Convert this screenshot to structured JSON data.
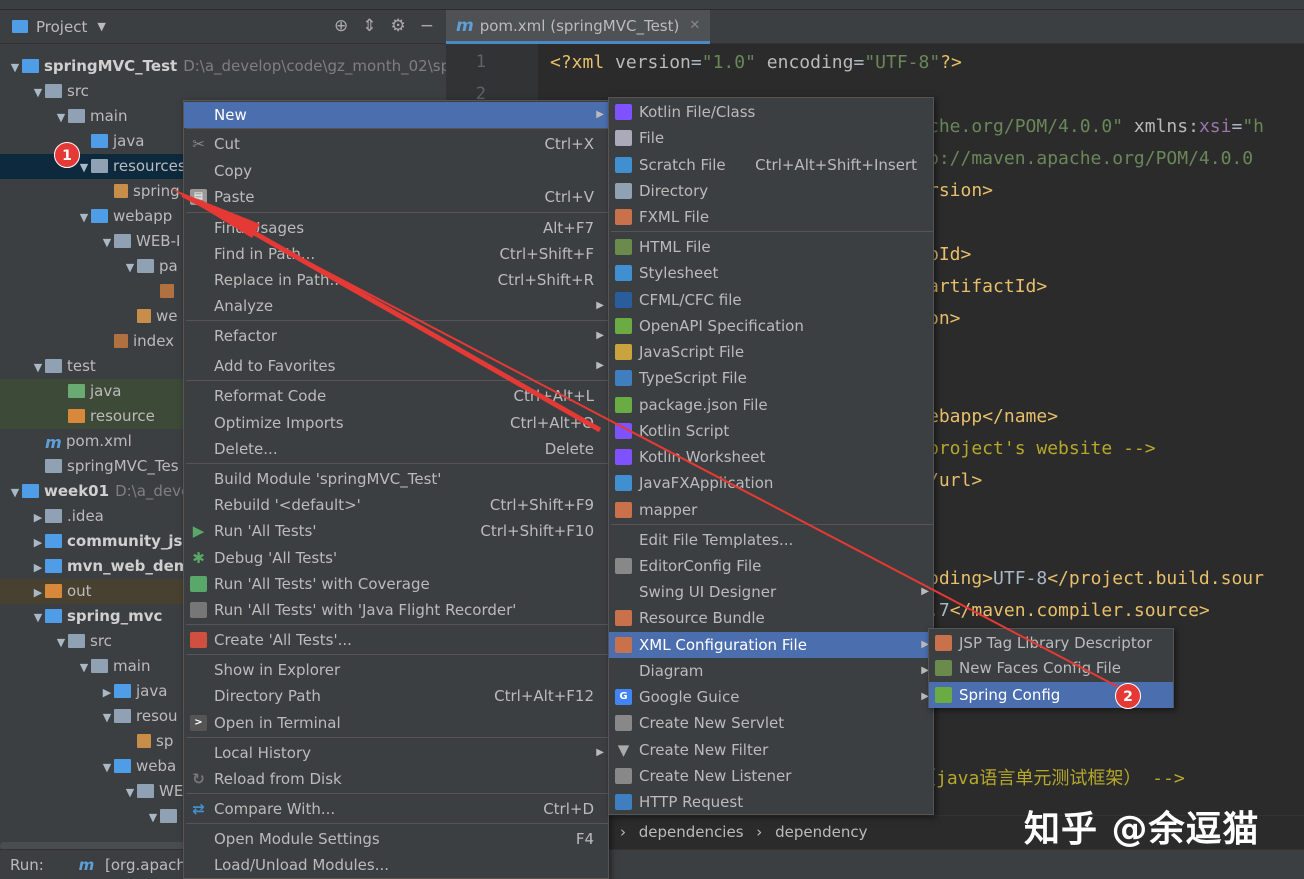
{
  "project_panel": {
    "title": "Project",
    "tree": [
      {
        "label": "springMVC_Test",
        "path": "D:\\a_develop\\code\\gz_month_02\\sp",
        "bold": true
      },
      {
        "label": "src"
      },
      {
        "label": "main"
      },
      {
        "label": "java"
      },
      {
        "label": "resources"
      },
      {
        "label": "spring"
      },
      {
        "label": "webapp"
      },
      {
        "label": "WEB-I"
      },
      {
        "label": "pa"
      },
      {
        "label": ""
      },
      {
        "label": "we"
      },
      {
        "label": "index"
      },
      {
        "label": "test"
      },
      {
        "label": "java"
      },
      {
        "label": "resource"
      },
      {
        "label": "pom.xml"
      },
      {
        "label": "springMVC_Tes"
      },
      {
        "label": "week01",
        "path": "D:\\a_deve",
        "bold": true
      },
      {
        "label": ".idea"
      },
      {
        "label": "community_jsp",
        "bold": true
      },
      {
        "label": "mvn_web_dem",
        "bold": true
      },
      {
        "label": "out"
      },
      {
        "label": "spring_mvc",
        "bold": true
      },
      {
        "label": "src"
      },
      {
        "label": "main"
      },
      {
        "label": "java"
      },
      {
        "label": "resou"
      },
      {
        "label": "sp"
      },
      {
        "label": "weba"
      },
      {
        "label": "WE"
      },
      {
        "label": ""
      }
    ]
  },
  "editor": {
    "tab_label": "pom.xml (springMVC_Test)",
    "line_numbers": [
      "1",
      "2"
    ],
    "lines": [
      {
        "parts": [
          [
            "tag",
            "<?xml "
          ],
          [
            "attr",
            "version"
          ],
          [
            "w",
            "="
          ],
          [
            "str",
            "\"1.0\""
          ],
          [
            "w",
            " "
          ],
          [
            "attr",
            "encoding"
          ],
          [
            "w",
            "="
          ],
          [
            "str",
            "\"UTF-8\""
          ],
          [
            "tag",
            "?>"
          ]
        ]
      },
      {
        "parts": [
          [
            "str",
            "che.org/POM/4.0.0\""
          ],
          [
            "w",
            " "
          ],
          [
            "attr",
            "xmlns"
          ],
          [
            "w",
            ":"
          ],
          [
            "ns",
            "xsi"
          ],
          [
            "w",
            "="
          ],
          [
            "str",
            "\"h"
          ]
        ]
      },
      {
        "parts": [
          [
            "str",
            "p://maven.apache.org/POM/4.0.0 "
          ]
        ]
      },
      {
        "parts": [
          [
            "tag",
            "rsion>"
          ]
        ]
      },
      {
        "parts": [
          [
            "tag",
            "pId>"
          ]
        ]
      },
      {
        "parts": [
          [
            "tag",
            "artifactId>"
          ]
        ]
      },
      {
        "parts": [
          [
            "tag",
            "on>"
          ]
        ]
      },
      {
        "parts": [
          [
            "tag",
            "ebapp"
          ],
          [
            "w",
            ""
          ],
          [
            "tag",
            "</name>"
          ]
        ]
      },
      {
        "parts": [
          [
            "com",
            "project's website -->"
          ]
        ]
      },
      {
        "parts": [
          [
            "tag",
            "/url>"
          ]
        ]
      },
      {
        "parts": [
          [
            "tag",
            "oding>"
          ],
          [
            "w",
            "UTF-8"
          ],
          [
            "tag",
            "</project.build.sour"
          ]
        ]
      },
      {
        "parts": [
          [
            "w",
            ".7"
          ],
          [
            "tag",
            "</maven.compiler.source>"
          ]
        ]
      },
      {
        "parts": [
          [
            "tag",
            "arget>"
          ]
        ]
      },
      {
        "parts": [
          [
            "com",
            "（java语言单元测试框架） -->"
          ]
        ]
      }
    ],
    "breadcrumb": [
      "dependencies",
      "dependency"
    ]
  },
  "context_menu": {
    "items": [
      {
        "label": "New",
        "active": true,
        "submenu": true
      },
      {
        "label": "Cut",
        "shortcut": "Ctrl+X",
        "icon": "scissors-icon"
      },
      {
        "label": "Copy"
      },
      {
        "label": "Paste",
        "shortcut": "Ctrl+V",
        "icon": "clipboard-icon"
      },
      {
        "label": "Find Usages",
        "shortcut": "Alt+F7"
      },
      {
        "label": "Find in Path...",
        "shortcut": "Ctrl+Shift+F"
      },
      {
        "label": "Replace in Path...",
        "shortcut": "Ctrl+Shift+R"
      },
      {
        "label": "Analyze",
        "submenu": true
      },
      {
        "label": "Refactor",
        "submenu": true
      },
      {
        "label": "Add to Favorites",
        "submenu": true
      },
      {
        "label": "Reformat Code",
        "shortcut": "Ctrl+Alt+L"
      },
      {
        "label": "Optimize Imports",
        "shortcut": "Ctrl+Alt+O"
      },
      {
        "label": "Delete...",
        "shortcut": "Delete"
      },
      {
        "label": "Build Module 'springMVC_Test'"
      },
      {
        "label": "Rebuild '<default>'",
        "shortcut": "Ctrl+Shift+F9"
      },
      {
        "label": "Run 'All Tests'",
        "shortcut": "Ctrl+Shift+F10",
        "icon": "run-icon"
      },
      {
        "label": "Debug 'All Tests'",
        "icon": "debug-icon"
      },
      {
        "label": "Run 'All Tests' with Coverage",
        "icon": "coverage-icon"
      },
      {
        "label": "Run 'All Tests' with 'Java Flight Recorder'",
        "icon": "flight-recorder-icon"
      },
      {
        "label": "Create 'All Tests'...",
        "icon": "create-test-icon"
      },
      {
        "label": "Show in Explorer"
      },
      {
        "label": "Directory Path",
        "shortcut": "Ctrl+Alt+F12"
      },
      {
        "label": "Open in Terminal",
        "icon": "terminal-icon"
      },
      {
        "label": "Local History",
        "submenu": true
      },
      {
        "label": "Reload from Disk",
        "icon": "reload-icon"
      },
      {
        "label": "Compare With...",
        "shortcut": "Ctrl+D",
        "icon": "compare-icon"
      },
      {
        "label": "Open Module Settings",
        "shortcut": "F4"
      },
      {
        "label": "Load/Unload Modules..."
      }
    ]
  },
  "new_submenu": {
    "items": [
      {
        "label": "Kotlin File/Class",
        "icon": "kotlin-file-icon"
      },
      {
        "label": "File",
        "icon": "file-icon"
      },
      {
        "label": "Scratch File",
        "shortcut": "Ctrl+Alt+Shift+Insert",
        "icon": "scratch-file-icon"
      },
      {
        "label": "Directory",
        "icon": "folder-icon"
      },
      {
        "label": "FXML File",
        "icon": "fxml-file-icon"
      },
      {
        "label": "HTML File",
        "icon": "html-file-icon"
      },
      {
        "label": "Stylesheet",
        "icon": "css-file-icon"
      },
      {
        "label": "CFML/CFC file",
        "icon": "cfml-file-icon"
      },
      {
        "label": "OpenAPI Specification",
        "icon": "openapi-icon"
      },
      {
        "label": "JavaScript File",
        "icon": "js-file-icon"
      },
      {
        "label": "TypeScript File",
        "icon": "ts-file-icon"
      },
      {
        "label": "package.json File",
        "icon": "nodejs-icon"
      },
      {
        "label": "Kotlin Script",
        "icon": "kotlin-script-icon"
      },
      {
        "label": "Kotlin Worksheet",
        "icon": "kotlin-worksheet-icon"
      },
      {
        "label": "JavaFXApplication",
        "icon": "javafx-icon"
      },
      {
        "label": "mapper",
        "icon": "mapper-icon"
      },
      {
        "label": "Edit File Templates..."
      },
      {
        "label": "EditorConfig File",
        "icon": "editorconfig-icon"
      },
      {
        "label": "Swing UI Designer",
        "submenu": true
      },
      {
        "label": "Resource Bundle",
        "icon": "resource-bundle-icon"
      },
      {
        "label": "XML Configuration File",
        "active": true,
        "submenu": true,
        "icon": "xml-file-icon"
      },
      {
        "label": "Diagram",
        "submenu": true
      },
      {
        "label": "Google Guice",
        "submenu": true,
        "icon": "google-icon"
      },
      {
        "label": "Create New Servlet",
        "icon": "servlet-icon"
      },
      {
        "label": "Create New Filter",
        "icon": "filter-icon"
      },
      {
        "label": "Create New Listener",
        "icon": "listener-icon"
      },
      {
        "label": "HTTP Request",
        "icon": "api-icon"
      }
    ]
  },
  "xml_submenu": {
    "items": [
      {
        "label": "JSP Tag Library Descriptor",
        "icon": "jsp-tld-icon"
      },
      {
        "label": "New Faces Config File",
        "icon": "jsf-icon"
      },
      {
        "label": "Spring Config",
        "active": true,
        "icon": "spring-icon"
      }
    ]
  },
  "annotations": {
    "badge1": "1",
    "badge2": "2"
  },
  "status_bar": {
    "run_label": "Run:",
    "run_tab": "[org.apache."
  },
  "watermark": "知乎 @余逗猫",
  "colors": {
    "accent": "#4b6eaf",
    "badge": "#e53935",
    "arrow": "#e53935"
  }
}
